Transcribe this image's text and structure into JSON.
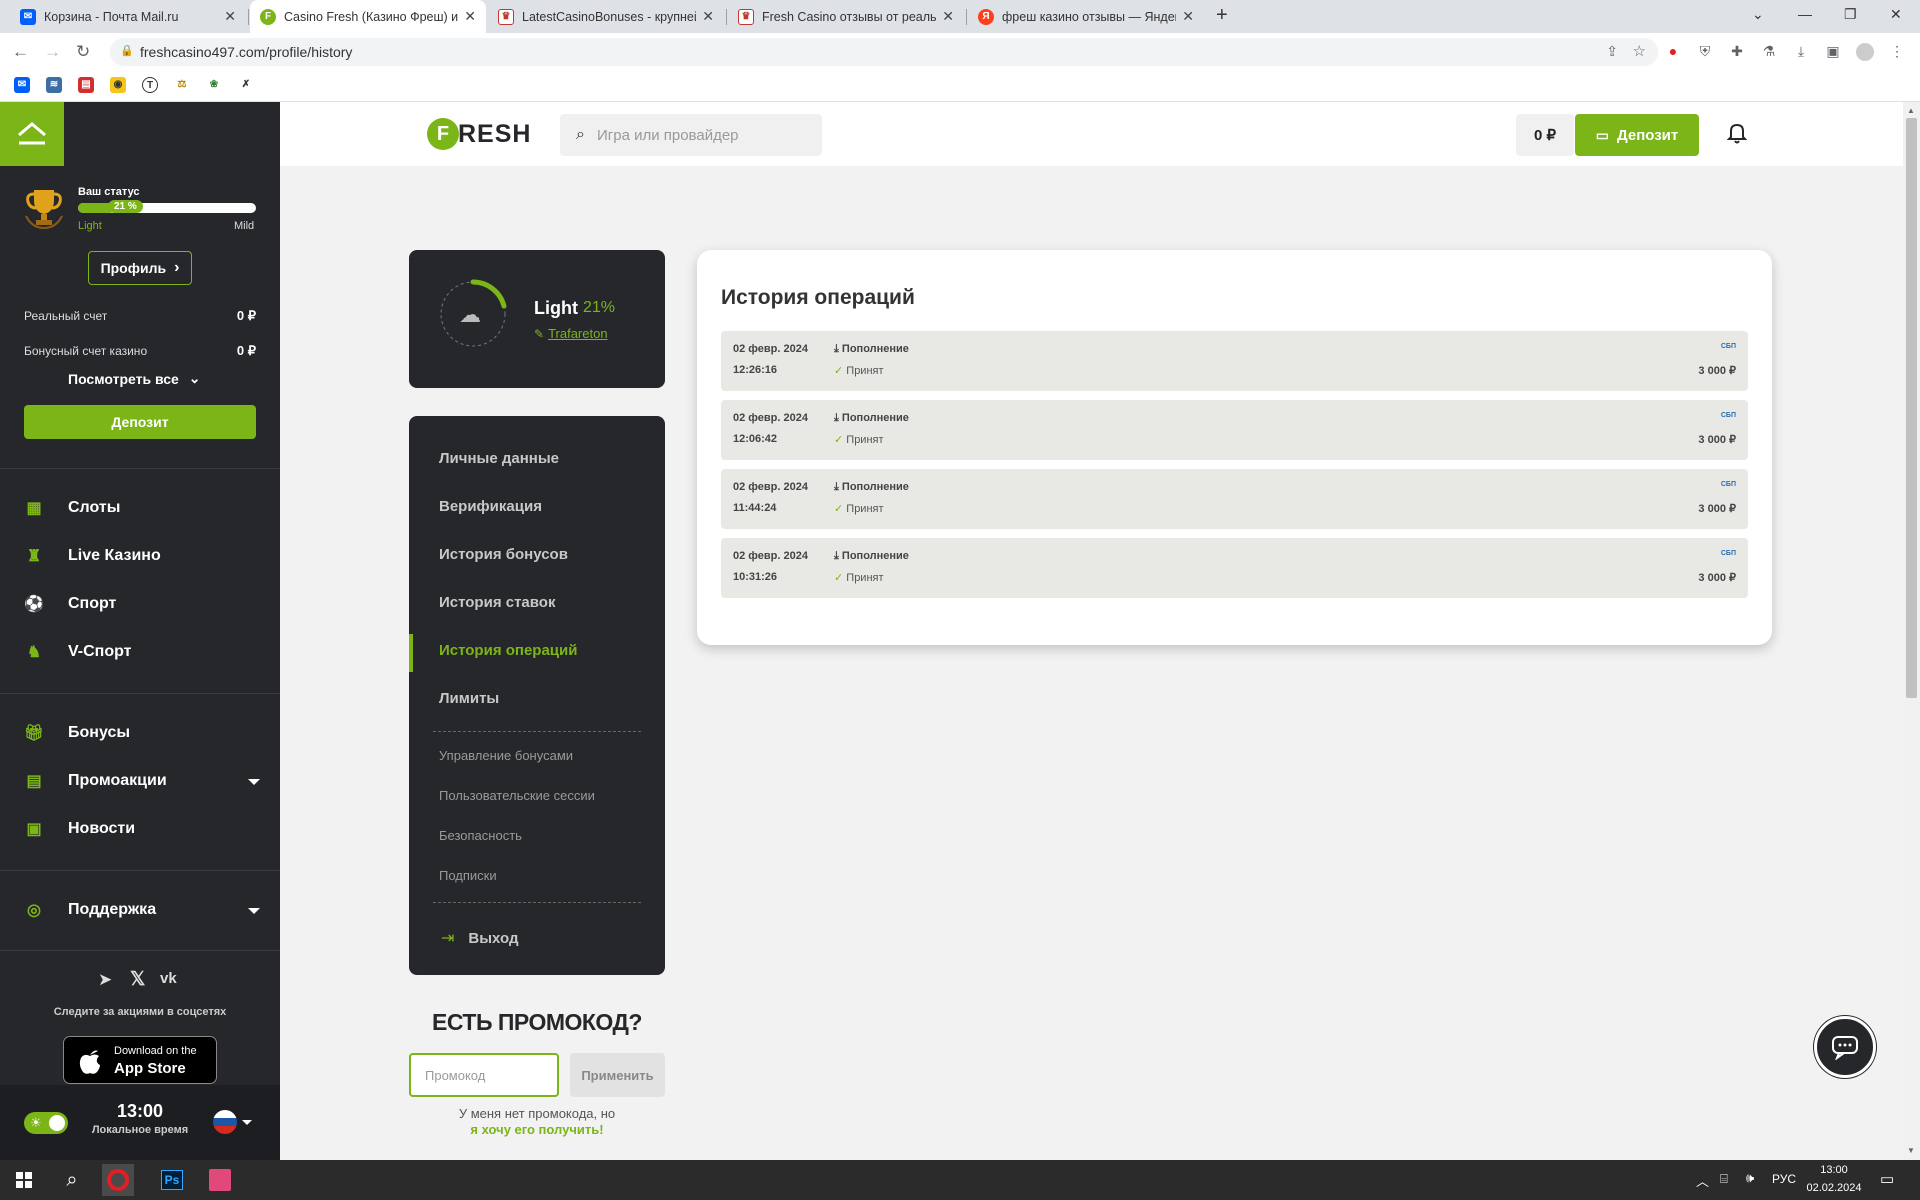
{
  "browser": {
    "tabs": [
      {
        "title": "Корзина - Почта Mail.ru",
        "icon": "mail-icon",
        "color": "#005ff9"
      },
      {
        "title": "Casino Fresh (Казино Фреш) игр",
        "icon": "fresh-icon",
        "color": "#7cb518"
      },
      {
        "title": "LatestCasinoBonuses - крупнейш",
        "icon": "lcb-icon",
        "color": "#c0392b"
      },
      {
        "title": "Fresh Casino отзывы от реальны",
        "icon": "lcb-icon",
        "color": "#c0392b"
      },
      {
        "title": "фреш казино отзывы — Яндекс",
        "icon": "yandex-icon",
        "color": "#fc3f1d"
      }
    ],
    "url": "freshcasino497.com/profile/history"
  },
  "sidebar": {
    "status_label": "Ваш статус",
    "status_percent": "21 %",
    "status_progress": 0.21,
    "level_from": "Light",
    "level_to": "Mild",
    "profile_button": "Профиль",
    "real_account_label": "Реальный счет",
    "real_account_value": "0 ₽",
    "bonus_account_label": "Бонусный счет казино",
    "bonus_account_value": "0 ₽",
    "view_all": "Посмотреть все",
    "deposit_button": "Депозит",
    "nav": [
      {
        "label": "Слоты",
        "icon": "slots-icon"
      },
      {
        "label": "Live Казино",
        "icon": "live-casino-icon"
      },
      {
        "label": "Спорт",
        "icon": "sport-icon"
      },
      {
        "label": "V-Спорт",
        "icon": "vsport-icon"
      }
    ],
    "nav2": [
      {
        "label": "Бонусы",
        "icon": "gift-icon"
      },
      {
        "label": "Промоакции",
        "icon": "calendar-icon"
      },
      {
        "label": "Новости",
        "icon": "news-icon"
      }
    ],
    "support": "Поддержка",
    "social_text": "Следите за акциями в соцсетях",
    "appstore_small": "Download on the",
    "appstore_big": "App Store",
    "time": "13:00",
    "time_label": "Локальное время"
  },
  "header": {
    "logo": "FRESH",
    "search_placeholder": "Игра или провайдер",
    "balance": "0 ₽",
    "deposit_button": "Депозит"
  },
  "profile": {
    "level": "Light",
    "percent": "21%",
    "progress": 0.21,
    "username": "Trafareton"
  },
  "menu": {
    "items": [
      "Личные данные",
      "Верификация",
      "История бонусов",
      "История ставок",
      "История операций",
      "Лимиты"
    ],
    "active_index": 4,
    "sub_items": [
      "Управление бонусами",
      "Пользовательские сессии",
      "Безопасность",
      "Подписки"
    ],
    "logout": "Выход"
  },
  "promo": {
    "title": "ЕСТЬ ПРОМОКОД?",
    "placeholder": "Промокод",
    "apply_button": "Применить",
    "no_code_text": "У меня нет промокода, но",
    "get_link": "я хочу его получить!"
  },
  "history": {
    "title": "История операций",
    "rows": [
      {
        "date": "02 февр. 2024",
        "time": "12:26:16",
        "type": "Пополнение",
        "status": "Принят",
        "amount": "3 000 ₽",
        "method": "СБП"
      },
      {
        "date": "02 февр. 2024",
        "time": "12:06:42",
        "type": "Пополнение",
        "status": "Принят",
        "amount": "3 000 ₽",
        "method": "СБП"
      },
      {
        "date": "02 февр. 2024",
        "time": "11:44:24",
        "type": "Пополнение",
        "status": "Принят",
        "amount": "3 000 ₽",
        "method": "СБП"
      },
      {
        "date": "02 февр. 2024",
        "time": "10:31:26",
        "type": "Пополнение",
        "status": "Принят",
        "amount": "3 000 ₽",
        "method": "СБП"
      }
    ]
  },
  "taskbar": {
    "lang": "РУС",
    "time": "13:00",
    "date": "02.02.2024"
  },
  "colors": {
    "accent": "#7cb518",
    "dark": "#25272a"
  }
}
